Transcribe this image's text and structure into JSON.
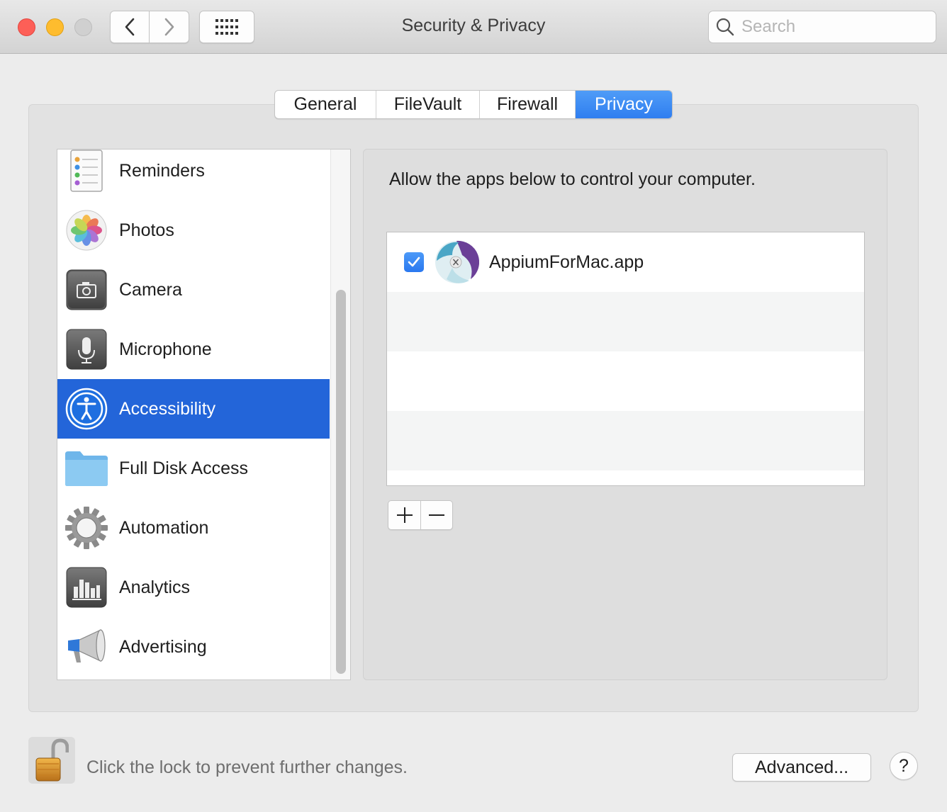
{
  "window": {
    "title": "Security & Privacy",
    "search_placeholder": "Search"
  },
  "tabs": [
    {
      "label": "General",
      "active": false
    },
    {
      "label": "FileVault",
      "active": false
    },
    {
      "label": "Firewall",
      "active": false
    },
    {
      "label": "Privacy",
      "active": true
    }
  ],
  "sidebar": {
    "items": [
      {
        "label": "Reminders",
        "icon": "reminders-icon"
      },
      {
        "label": "Photos",
        "icon": "photos-icon"
      },
      {
        "label": "Camera",
        "icon": "camera-icon"
      },
      {
        "label": "Microphone",
        "icon": "microphone-icon"
      },
      {
        "label": "Accessibility",
        "icon": "accessibility-icon",
        "selected": true
      },
      {
        "label": "Full Disk Access",
        "icon": "folder-icon"
      },
      {
        "label": "Automation",
        "icon": "gear-icon"
      },
      {
        "label": "Analytics",
        "icon": "analytics-icon"
      },
      {
        "label": "Advertising",
        "icon": "megaphone-icon"
      }
    ]
  },
  "panel": {
    "description": "Allow the apps below to control your computer.",
    "apps": [
      {
        "name": "AppiumForMac.app",
        "checked": true,
        "icon": "appium-icon"
      }
    ],
    "add_label": "+",
    "remove_label": "—"
  },
  "footer": {
    "lock_text": "Click the lock to prevent further changes.",
    "advanced_label": "Advanced...",
    "help_label": "?"
  },
  "colors": {
    "accent": "#2365d9",
    "tab_active": "#3a86f4"
  }
}
